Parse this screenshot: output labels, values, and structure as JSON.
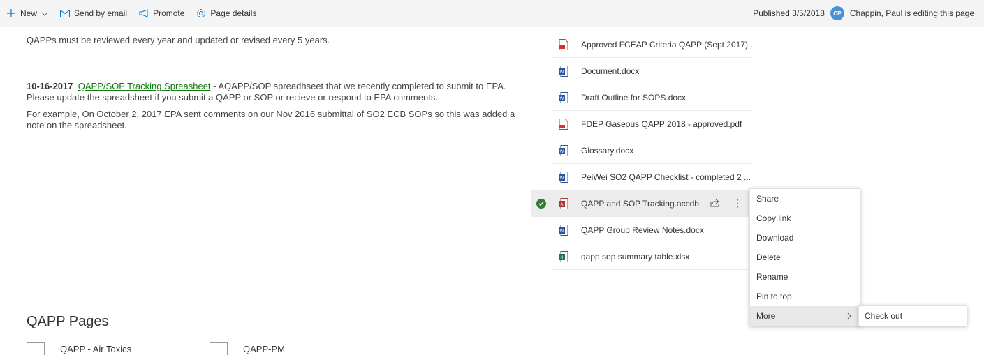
{
  "command_bar": {
    "new_label": "New",
    "send_email_label": "Send by email",
    "promote_label": "Promote",
    "page_details_label": "Page details",
    "published_text": "Published 3/5/2018",
    "avatar_initials": "CP",
    "editing_text": "Chappin, Paul is editing this page"
  },
  "content": {
    "review_text": "QAPPs must be reviewed every year and updated or revised every 5 years.",
    "tracking_date": "10-16-2017",
    "tracking_link": "QAPP/SOP Tracking Spreasheet",
    "tracking_text": " - AQAPP/SOP spreadhseet that we recently completed to submit to EPA.  Please update the spreadsheet if you submit a QAPP or SOP or recieve or respond to EPA comments.",
    "example_text": "For example, On October 2, 2017 EPA sent comments on our Nov 2016 submittal of SO2 ECB SOPs so this was added a note on the spreadsheet.",
    "section_title": "QAPP Pages",
    "pages": [
      "QAPP - Air Toxics",
      "QAPP-PM"
    ]
  },
  "files": [
    {
      "name": "Approved FCEAP Criteria QAPP (Sept 2017)....",
      "type": "pdf"
    },
    {
      "name": "Document.docx",
      "type": "word"
    },
    {
      "name": "Draft Outline for SOPS.docx",
      "type": "word"
    },
    {
      "name": "FDEP Gaseous QAPP 2018 - approved.pdf",
      "type": "pdf"
    },
    {
      "name": "Glossary.docx",
      "type": "word"
    },
    {
      "name": "PeiWei SO2 QAPP Checklist - completed 2 ...",
      "type": "word"
    },
    {
      "name": "QAPP and SOP Tracking.accdb",
      "type": "access",
      "selected": true
    },
    {
      "name": "QAPP Group Review Notes.docx",
      "type": "word"
    },
    {
      "name": "qapp sop summary table.xlsx",
      "type": "excel"
    }
  ],
  "context_menu": [
    "Share",
    "Copy link",
    "Download",
    "Delete",
    "Rename",
    "Pin to top",
    "More"
  ],
  "submenu": [
    "Check out"
  ],
  "colors": {
    "accent": "#4a90d9",
    "link": "#107c10",
    "check": "#2e7d32",
    "pdf": "#d13438",
    "word": "#2b579a",
    "excel": "#217346",
    "access": "#a4373a"
  }
}
